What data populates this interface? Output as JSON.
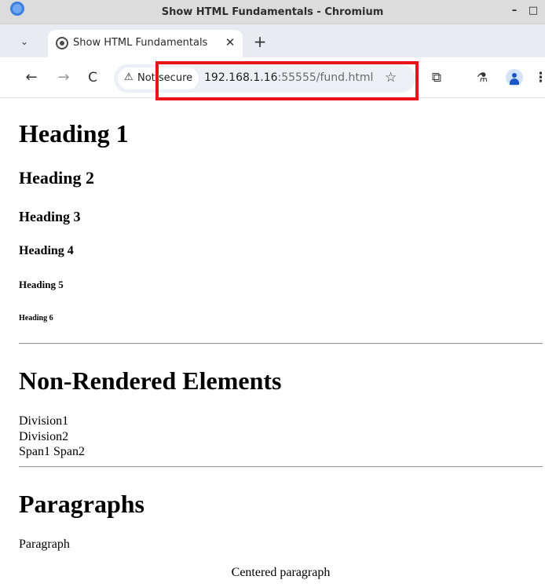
{
  "window": {
    "title": "Show HTML Fundamentals - Chromium",
    "minimize_glyph": "–",
    "maximize_glyph": "□"
  },
  "tabs": {
    "search_glyph": "⌄",
    "active_title": "Show HTML Fundamentals",
    "close_glyph": "✕",
    "new_tab_glyph": "+"
  },
  "toolbar": {
    "back_glyph": "←",
    "forward_glyph": "→",
    "reload_glyph": "C",
    "security_icon": "⚠",
    "security_label": "Not secure",
    "url_host": "192.168.1.16",
    "url_rest": ":55555/fund.html",
    "star_glyph": "☆",
    "extensions_glyph": "⧉",
    "labs_glyph": "⚗",
    "menu_glyph": "⋮",
    "highlight_color": "#e8141a"
  },
  "page": {
    "heading1": "Heading 1",
    "heading2": "Heading 2",
    "heading3": "Heading 3",
    "heading4": "Heading 4",
    "heading5": "Heading 5",
    "heading6": "Heading 6",
    "section_non_rendered": "Non-Rendered Elements",
    "division1": "Division1",
    "division2": "Division2",
    "spans": "Span1 Span2",
    "section_paragraphs": "Paragraphs",
    "paragraph": "Paragraph",
    "centered_paragraph": "Centered paragraph"
  }
}
